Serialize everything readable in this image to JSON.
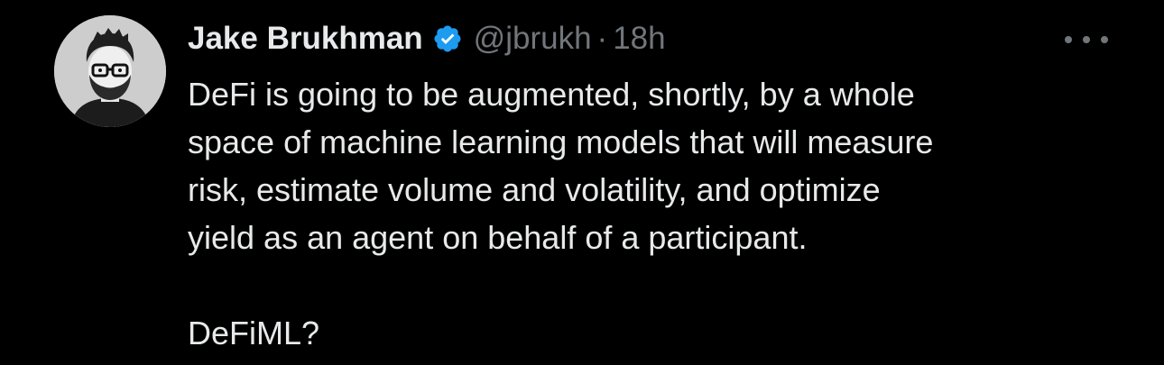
{
  "tweet": {
    "author": {
      "display_name": "Jake Brukhman",
      "handle": "@jbrukh",
      "verified": true,
      "verified_icon": "verified-badge-icon",
      "avatar_icon": "avatar"
    },
    "separator": "·",
    "time_ago": "18h",
    "more_icon": "more-options-icon",
    "text_lines": [
      "DeFi is going to be augmented, shortly, by a whole",
      "space of machine learning models that will measure",
      "risk, estimate volume and volatility, and optimize",
      "yield as an agent on behalf of a participant."
    ],
    "closing_line": "DeFiML?"
  },
  "colors": {
    "background": "#000000",
    "primary_text": "#e7e9ea",
    "secondary_text": "#71767b",
    "verified_blue": "#1d9bf0"
  }
}
